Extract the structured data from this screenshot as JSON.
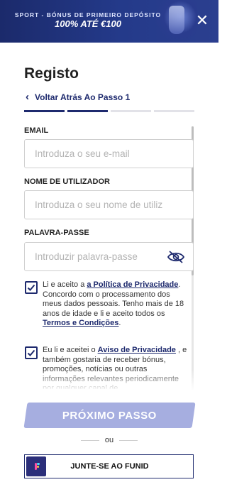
{
  "banner": {
    "top_line": "SPORT - BÓNUS DE PRIMEIRO DEPÓSITO",
    "main_line": "100% ATÉ €100",
    "close_symbol": "✕"
  },
  "header": {
    "title": "Registo",
    "back_label": "Voltar Atrás Ao Passo 1",
    "progress_steps": 4,
    "progress_active": 2
  },
  "form": {
    "email_label": "EMAIL",
    "email_placeholder": "Introduza o seu e-mail",
    "username_label": "NOME DE UTILIZADOR",
    "username_placeholder": "Introduza o seu nome de utiliz",
    "password_label": "PALAVRA-PASSE",
    "password_placeholder": "Introduzir palavra-passe",
    "privacy_consent": {
      "checked": true,
      "text_1": "Li e aceito a ",
      "link_1": "a Política de Privacidade",
      "text_2": ". Concordo com o processamento dos meus dados pessoais. Tenho mais de 18 anos de idade e li e aceito todos os ",
      "link_2": "Termos e Condições",
      "text_3": "."
    },
    "marketing_consent": {
      "checked": true,
      "text_1": "Eu li e aceitei o ",
      "link_1": "Aviso de Privacidade",
      "text_2": " , e também gostaria de receber bónus, promoções, notícias ou outras informações relevantes periodicamente por qualquer canal de"
    }
  },
  "actions": {
    "next_label": "PRÓXIMO PASSO",
    "or_label": "ou",
    "funid_label": "JUNTE-SE AO FUNID"
  },
  "colors": {
    "banner": "#243a8a",
    "accent": "#1e2a6e",
    "next_button": "#a6aee0",
    "funid_logo": "#2b2f7a"
  },
  "icons": [
    "close-icon",
    "chevron-left-icon",
    "eye-slash-icon",
    "check-icon",
    "funid-logo-icon"
  ]
}
